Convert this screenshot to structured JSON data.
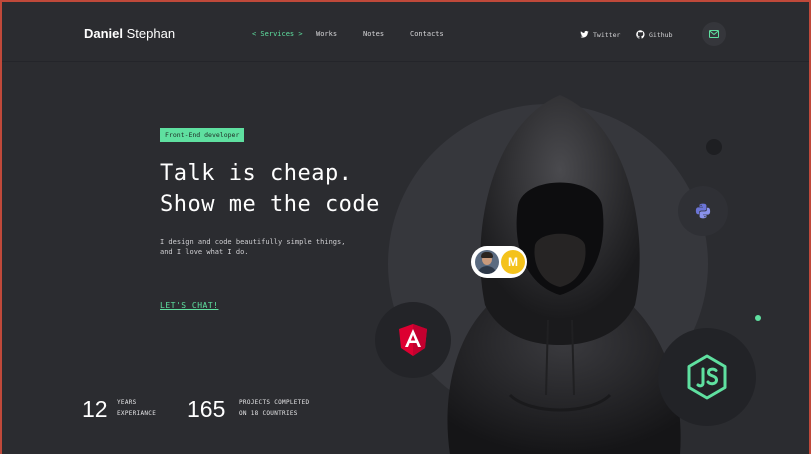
{
  "header": {
    "logo_first": "Daniel",
    "logo_last": " Stephan",
    "nav": [
      "< Services >",
      "Works",
      "Notes",
      "Contacts"
    ],
    "social": [
      "Twitter",
      "Github"
    ],
    "mail_icon": "mail-icon"
  },
  "hero": {
    "badge": "Front-End developer",
    "headline_line1": "Talk is cheap.",
    "headline_line2": "Show me the code",
    "sub_line1": "I design and code beautifully simple things,",
    "sub_line2": "and I love what I do.",
    "cta": "LET'S CHAT!"
  },
  "stats": [
    {
      "number": "12",
      "label1": "YEARS",
      "label2": "EXPERIANCE"
    },
    {
      "number": "165",
      "label1": "PROJECTS COMPLETED",
      "label2": "ON 18 COUNTRIES"
    }
  ],
  "floating": {
    "pill_letter": "M",
    "tech_icons": [
      "python-icon",
      "angular-icon",
      "nodejs-icon"
    ]
  },
  "colors": {
    "background": "#2b2c30",
    "accent": "#5fe0a0",
    "angular": "#dd0031",
    "python": "#6b74d6",
    "avatar_m": "#f4c21b"
  }
}
